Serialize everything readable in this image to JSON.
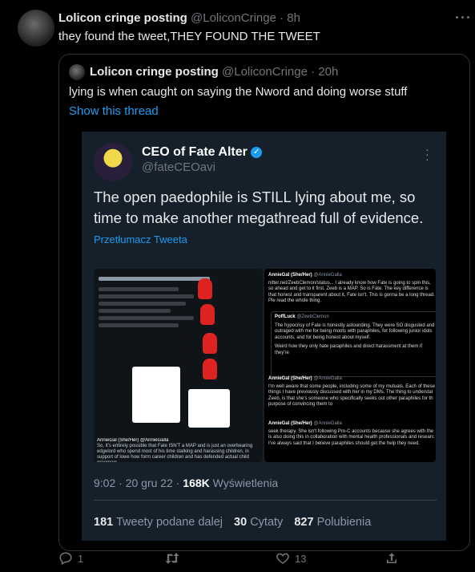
{
  "tweet": {
    "display_name": "Lolicon cringe posting",
    "handle": "@LoliconCringe",
    "time": "· 8h",
    "text": "they found the tweet,THEY FOUND THE TWEET"
  },
  "quote": {
    "display_name": "Lolicon cringe posting",
    "handle": "@LoliconCringe",
    "time": "· 20h",
    "text": "lying is when caught on saying the Nword and doing worse stuff",
    "show_thread": "Show this thread"
  },
  "embedded": {
    "display_name": "CEO of Fate Alter",
    "handle": "@fateCEOavi",
    "text": "The open paedophile is STILL lying about me, so time to make another megathread full of evidence.",
    "translate": "Przetłumacz Tweeta",
    "time": "9:02 · 20 gru 22 ·",
    "views_count": "168K",
    "views_label": "Wyświetlenia",
    "retweets_count": "181",
    "retweets_label": "Tweety podane dalej",
    "quotes_count": "30",
    "quotes_label": "Cytaty",
    "likes_count": "827",
    "likes_label": "Polubienia"
  },
  "screenshot_right": {
    "post1_name": "AnnieGal (She/Her)",
    "post1_handle": "@AnnieGalla",
    "post1_text": "nitter.net/ZeebClemon/status...  I already know how Fate is going to spin this, so ahead and get to it first. Zeeb is a MAP. So is Fate. The key difference is that honest and transparent about it, Fate isn't. This is gonna be a long thread. Ple read the whole thing.",
    "quoted_name": "PoffLuck",
    "quoted_handle": "@ZeebClemon",
    "quoted_text": "The hypocrisy of Fate is honestly astounding. They were SO disgusted and outraged with me for being moots with paraphiles, for following junior idols accounts, and for being honest about myself.",
    "quoted_text2": "Weird how they only hate paraphiles and direct harassment at them if they're",
    "post2_name": "AnnieGal (She/Her)",
    "post2_handle": "@AnnieGalla",
    "post2_text": "I'm well aware that some people, including some of my mutuals. Each of these things I have previously discussed with her in my DMs. The thing to understar Zeeb, is that she's someone who specifically seeks out other paraphiles for th purpose of convincing them to",
    "post3_name": "AnnieGal (She/Her)",
    "post3_handle": "@AnnieGalla",
    "post3_text": "seek therapy. She isn't following Pro-C accounts because she agrees with the is also doing this in collaboration with mental health professionals and researc I've always said that I believe paraphiles should get the help they need."
  },
  "screenshot_left": {
    "caption": "AnnieGal (She/Her)  @AnnieGalla",
    "caption_text": "So, it's entirely possible that Fate ISN'T a MAP and is just an overbearing edgelord who spend most of his time stalking and harassing children, in support of lowe how form career children and has defended actual child groomers"
  },
  "actions": {
    "replies": "1",
    "retweets": "",
    "likes": "13"
  },
  "colors": {
    "accent": "#1d9bf0",
    "muted": "#71767b",
    "embed_bg": "#15202b"
  }
}
